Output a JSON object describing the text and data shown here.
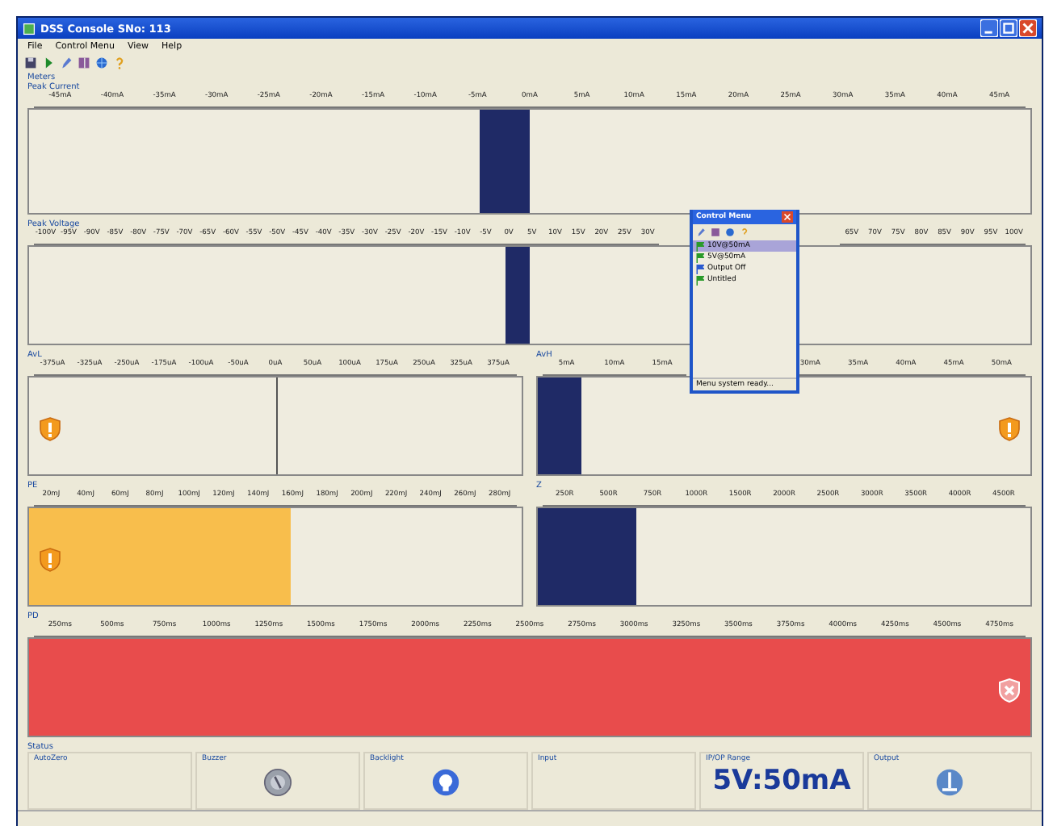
{
  "window": {
    "title": "DSS Console SNo: 113"
  },
  "menu": [
    "File",
    "Control Menu",
    "View",
    "Help"
  ],
  "group_label": "Meters",
  "meter_rows": [
    [
      {
        "label": "Peak Current",
        "kind": "bipolar",
        "level": 0.45,
        "color": "#1f2a66",
        "ticks": [
          "-45mA",
          "-40mA",
          "-35mA",
          "-30mA",
          "-25mA",
          "-20mA",
          "-15mA",
          "-10mA",
          "-5mA",
          "0mA",
          "5mA",
          "10mA",
          "15mA",
          "20mA",
          "25mA",
          "30mA",
          "35mA",
          "40mA",
          "45mA"
        ]
      }
    ],
    [
      {
        "label": "Peak Voltage",
        "kind": "bipolar",
        "level": 0.476,
        "color": "#1f2a66",
        "ticks": [
          "-100V",
          "-95V",
          "-90V",
          "-85V",
          "-80V",
          "-75V",
          "-70V",
          "-65V",
          "-60V",
          "-55V",
          "-50V",
          "-45V",
          "-40V",
          "-35V",
          "-30V",
          "-25V",
          "-20V",
          "-15V",
          "-10V",
          "-5V",
          "0V",
          "5V",
          "10V",
          "15V",
          "20V",
          "25V",
          "30V"
        ],
        "ticks_right": [
          "65V",
          "70V",
          "75V",
          "80V",
          "85V",
          "90V",
          "95V",
          "100V"
        ]
      }
    ],
    [
      {
        "label": "AvL",
        "kind": "center",
        "alert": {
          "kind": "warning"
        },
        "ticks": [
          "-375uA",
          "-325uA",
          "-250uA",
          "-175uA",
          "-100uA",
          "-50uA",
          "0uA",
          "50uA",
          "100uA",
          "175uA",
          "250uA",
          "325uA",
          "375uA"
        ]
      },
      {
        "label": "AvH",
        "kind": "unipolar",
        "level": 0.09,
        "color": "#1f2a66",
        "alert": {
          "kind": "warning"
        },
        "ticks": [
          "5mA",
          "10mA",
          "15mA"
        ],
        "ticks_right": [
          "30mA",
          "35mA",
          "40mA",
          "45mA",
          "50mA"
        ]
      }
    ],
    [
      {
        "label": "PE",
        "kind": "unipolar",
        "level": 0.53,
        "color": "#f8be4c",
        "alert": {
          "kind": "warning"
        },
        "ticks": [
          "20mJ",
          "40mJ",
          "60mJ",
          "80mJ",
          "100mJ",
          "120mJ",
          "140mJ",
          "160mJ",
          "180mJ",
          "200mJ",
          "220mJ",
          "240mJ",
          "260mJ",
          "280mJ"
        ]
      },
      {
        "label": "Z",
        "kind": "unipolar",
        "level": 0.2,
        "color": "#1f2a66",
        "ticks": [
          "250R",
          "500R",
          "750R",
          "1000R",
          "1500R",
          "2000R",
          "2500R",
          "3000R",
          "3500R",
          "4000R",
          "4500R"
        ]
      }
    ],
    [
      {
        "label": "PD",
        "kind": "unipolar",
        "level": 1,
        "color": "#e84c4c",
        "alert": {
          "kind": "error"
        },
        "ticks": [
          "250ms",
          "500ms",
          "750ms",
          "1000ms",
          "1250ms",
          "1500ms",
          "1750ms",
          "2000ms",
          "2250ms",
          "2500ms",
          "2750ms",
          "3000ms",
          "3250ms",
          "3500ms",
          "3750ms",
          "4000ms",
          "4250ms",
          "4500ms",
          "4750ms"
        ]
      }
    ]
  ],
  "status": {
    "label": "Status",
    "cells": [
      {
        "kind": "plain",
        "label": "AutoZero"
      },
      {
        "kind": "buzzer",
        "label": "Buzzer"
      },
      {
        "kind": "backlight",
        "label": "Backlight"
      },
      {
        "kind": "plain",
        "label": "Input"
      },
      {
        "kind": "range",
        "label": "IP/OP Range",
        "value": "5V:50mA"
      },
      {
        "kind": "output",
        "label": "Output"
      }
    ]
  },
  "control_menu": {
    "title": "Control Menu",
    "status": "Menu system ready...",
    "items": [
      {
        "label": "10V@50mA",
        "selected": true,
        "color": "#2a9a2a"
      },
      {
        "label": "5V@50mA",
        "selected": false,
        "color": "#2a9a2a"
      },
      {
        "label": "Output Off",
        "selected": false,
        "color": "#2a5ad0"
      },
      {
        "label": "Untitled",
        "selected": false,
        "color": "#2a9a2a"
      }
    ]
  }
}
